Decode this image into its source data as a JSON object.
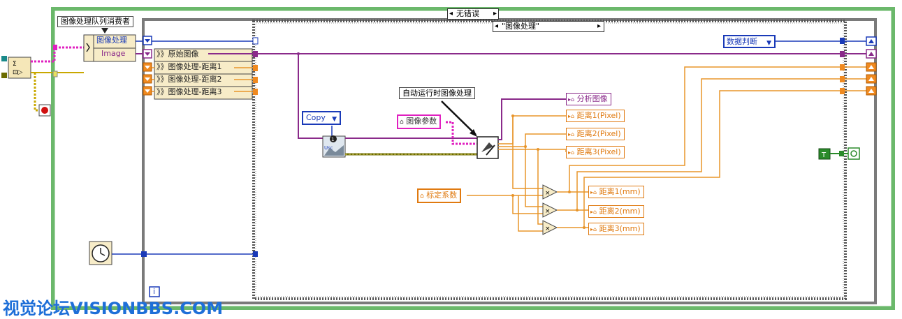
{
  "case_selector": {
    "value": "无错误",
    "arrow_left": "◂",
    "arrow_right": "▸"
  },
  "inner_case_selector": {
    "value": "\"图像处理\"",
    "arrow_left": "◂",
    "arrow_right": "▸"
  },
  "queue_label": "图像处理队列消费者",
  "unbundle": {
    "field1": "图像处理",
    "field2": "Image"
  },
  "cluster_items": [
    "》》原始图像",
    "》》图像处理-距离1",
    "》》图像处理-距离2",
    "》》图像处理-距离3"
  ],
  "copy_control": "Copy",
  "annotation": "自动运行时图像处理",
  "image_param": "图像参数",
  "analysis_image": "分析图像",
  "pixel_outputs": [
    "距离1(Pixel)",
    "距离2(Pixel)",
    "距离3(Pixel)"
  ],
  "calib_coefficient": "标定系数",
  "mm_outputs": [
    "距离1(mm)",
    "距离2(mm)",
    "距离3(mm)"
  ],
  "data_judgment": "数据判断",
  "iteration_label": "i",
  "watermark": "视觉论坛VISIONBBS.COM",
  "colors": {
    "orange_wire": "#e8952a",
    "pink_wire": "#e020c0",
    "purple_wire": "#8a2a8a",
    "blue_wire": "#1a3ab8",
    "green_frame": "#6bb86b"
  }
}
